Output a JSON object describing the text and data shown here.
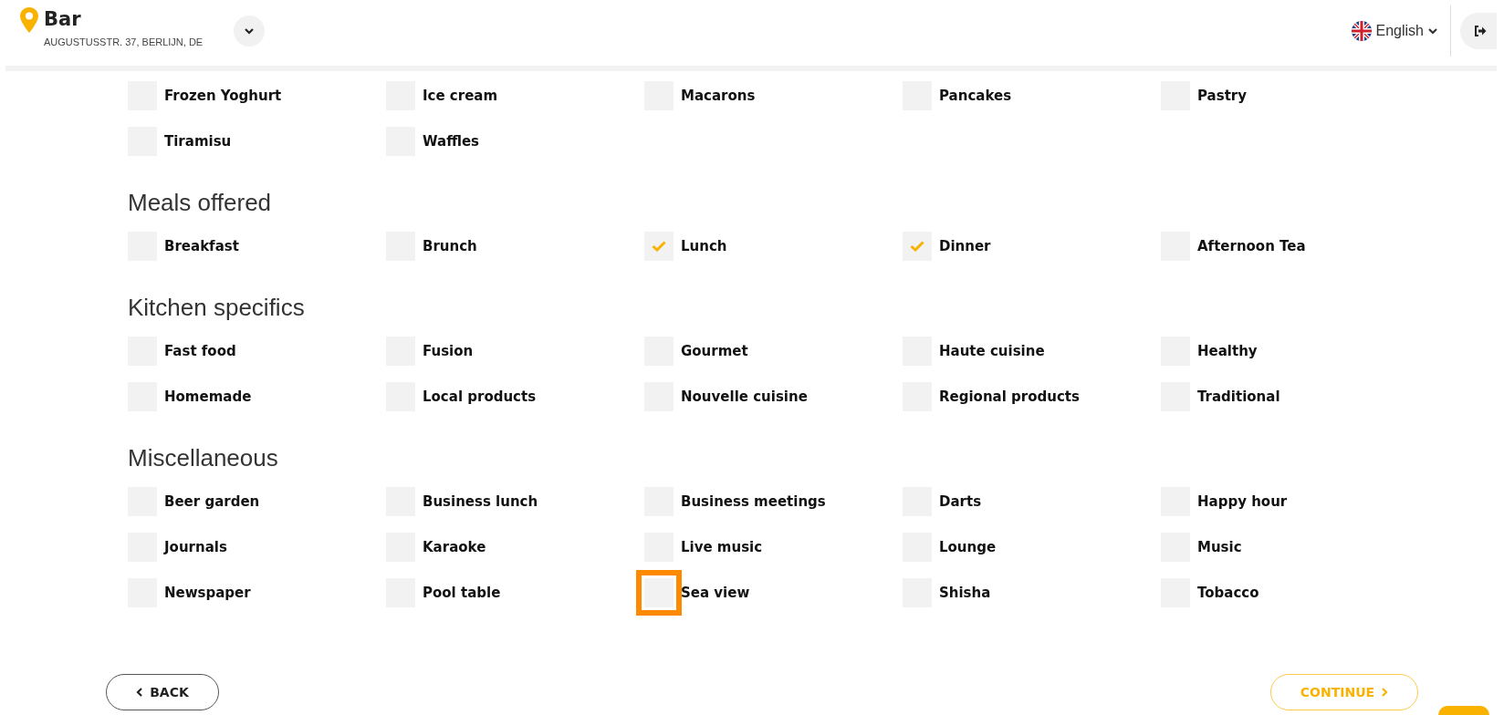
{
  "header": {
    "venue_name": "Bar",
    "address": "AUGUSTUSSTR. 37, BERLIJN, DE",
    "language": "English"
  },
  "sections": [
    {
      "items": [
        {
          "label": "Frozen Yoghurt",
          "checked": false,
          "highlighted": false
        },
        {
          "label": "Ice cream",
          "checked": false,
          "highlighted": false
        },
        {
          "label": "Macarons",
          "checked": false,
          "highlighted": false
        },
        {
          "label": "Pancakes",
          "checked": false,
          "highlighted": false
        },
        {
          "label": "Pastry",
          "checked": false,
          "highlighted": false
        },
        {
          "label": "Tiramisu",
          "checked": false,
          "highlighted": false
        },
        {
          "label": "Waffles",
          "checked": false,
          "highlighted": false
        }
      ]
    },
    {
      "title": "Meals offered",
      "items": [
        {
          "label": "Breakfast",
          "checked": false,
          "highlighted": false
        },
        {
          "label": "Brunch",
          "checked": false,
          "highlighted": false
        },
        {
          "label": "Lunch",
          "checked": true,
          "highlighted": false
        },
        {
          "label": "Dinner",
          "checked": true,
          "highlighted": false
        },
        {
          "label": "Afternoon Tea",
          "checked": false,
          "highlighted": false
        }
      ]
    },
    {
      "title": "Kitchen specifics",
      "items": [
        {
          "label": "Fast food",
          "checked": false,
          "highlighted": false
        },
        {
          "label": "Fusion",
          "checked": false,
          "highlighted": false
        },
        {
          "label": "Gourmet",
          "checked": false,
          "highlighted": false
        },
        {
          "label": "Haute cuisine",
          "checked": false,
          "highlighted": false
        },
        {
          "label": "Healthy",
          "checked": false,
          "highlighted": false
        },
        {
          "label": "Homemade",
          "checked": false,
          "highlighted": false
        },
        {
          "label": "Local products",
          "checked": false,
          "highlighted": false
        },
        {
          "label": "Nouvelle cuisine",
          "checked": false,
          "highlighted": false
        },
        {
          "label": "Regional products",
          "checked": false,
          "highlighted": false
        },
        {
          "label": "Traditional",
          "checked": false,
          "highlighted": false
        }
      ]
    },
    {
      "title": "Miscellaneous",
      "items": [
        {
          "label": "Beer garden",
          "checked": false,
          "highlighted": false
        },
        {
          "label": "Business lunch",
          "checked": false,
          "highlighted": false
        },
        {
          "label": "Business meetings",
          "checked": false,
          "highlighted": false
        },
        {
          "label": "Darts",
          "checked": false,
          "highlighted": false
        },
        {
          "label": "Happy hour",
          "checked": false,
          "highlighted": false
        },
        {
          "label": "Journals",
          "checked": false,
          "highlighted": false
        },
        {
          "label": "Karaoke",
          "checked": false,
          "highlighted": false
        },
        {
          "label": "Live music",
          "checked": false,
          "highlighted": false
        },
        {
          "label": "Lounge",
          "checked": false,
          "highlighted": false
        },
        {
          "label": "Music",
          "checked": false,
          "highlighted": false
        },
        {
          "label": "Newspaper",
          "checked": false,
          "highlighted": false
        },
        {
          "label": "Pool table",
          "checked": false,
          "highlighted": false
        },
        {
          "label": "Sea view",
          "checked": false,
          "highlighted": true
        },
        {
          "label": "Shisha",
          "checked": false,
          "highlighted": false
        },
        {
          "label": "Tobacco",
          "checked": false,
          "highlighted": false
        }
      ]
    }
  ],
  "buttons": {
    "back": "BACK",
    "continue": "CONTINUE"
  }
}
